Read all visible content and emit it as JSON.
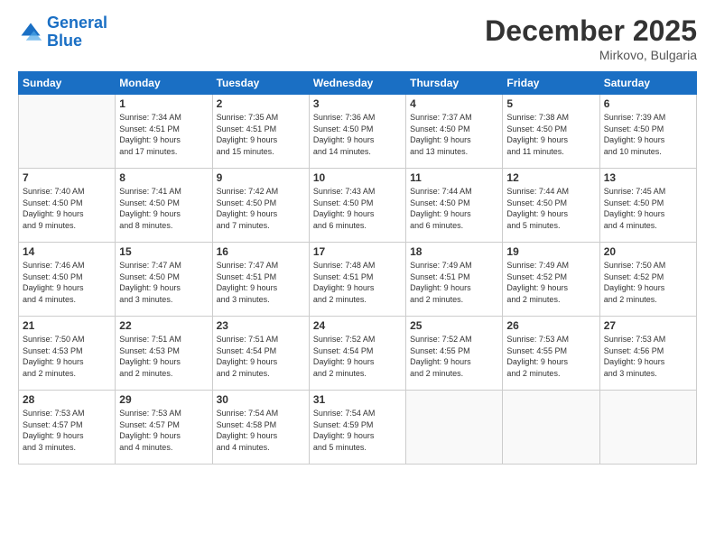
{
  "header": {
    "logo_line1": "General",
    "logo_line2": "Blue",
    "month": "December 2025",
    "location": "Mirkovo, Bulgaria"
  },
  "weekdays": [
    "Sunday",
    "Monday",
    "Tuesday",
    "Wednesday",
    "Thursday",
    "Friday",
    "Saturday"
  ],
  "weeks": [
    [
      {
        "day": "",
        "info": ""
      },
      {
        "day": "1",
        "info": "Sunrise: 7:34 AM\nSunset: 4:51 PM\nDaylight: 9 hours\nand 17 minutes."
      },
      {
        "day": "2",
        "info": "Sunrise: 7:35 AM\nSunset: 4:51 PM\nDaylight: 9 hours\nand 15 minutes."
      },
      {
        "day": "3",
        "info": "Sunrise: 7:36 AM\nSunset: 4:50 PM\nDaylight: 9 hours\nand 14 minutes."
      },
      {
        "day": "4",
        "info": "Sunrise: 7:37 AM\nSunset: 4:50 PM\nDaylight: 9 hours\nand 13 minutes."
      },
      {
        "day": "5",
        "info": "Sunrise: 7:38 AM\nSunset: 4:50 PM\nDaylight: 9 hours\nand 11 minutes."
      },
      {
        "day": "6",
        "info": "Sunrise: 7:39 AM\nSunset: 4:50 PM\nDaylight: 9 hours\nand 10 minutes."
      }
    ],
    [
      {
        "day": "7",
        "info": "Sunrise: 7:40 AM\nSunset: 4:50 PM\nDaylight: 9 hours\nand 9 minutes."
      },
      {
        "day": "8",
        "info": "Sunrise: 7:41 AM\nSunset: 4:50 PM\nDaylight: 9 hours\nand 8 minutes."
      },
      {
        "day": "9",
        "info": "Sunrise: 7:42 AM\nSunset: 4:50 PM\nDaylight: 9 hours\nand 7 minutes."
      },
      {
        "day": "10",
        "info": "Sunrise: 7:43 AM\nSunset: 4:50 PM\nDaylight: 9 hours\nand 6 minutes."
      },
      {
        "day": "11",
        "info": "Sunrise: 7:44 AM\nSunset: 4:50 PM\nDaylight: 9 hours\nand 6 minutes."
      },
      {
        "day": "12",
        "info": "Sunrise: 7:44 AM\nSunset: 4:50 PM\nDaylight: 9 hours\nand 5 minutes."
      },
      {
        "day": "13",
        "info": "Sunrise: 7:45 AM\nSunset: 4:50 PM\nDaylight: 9 hours\nand 4 minutes."
      }
    ],
    [
      {
        "day": "14",
        "info": "Sunrise: 7:46 AM\nSunset: 4:50 PM\nDaylight: 9 hours\nand 4 minutes."
      },
      {
        "day": "15",
        "info": "Sunrise: 7:47 AM\nSunset: 4:50 PM\nDaylight: 9 hours\nand 3 minutes."
      },
      {
        "day": "16",
        "info": "Sunrise: 7:47 AM\nSunset: 4:51 PM\nDaylight: 9 hours\nand 3 minutes."
      },
      {
        "day": "17",
        "info": "Sunrise: 7:48 AM\nSunset: 4:51 PM\nDaylight: 9 hours\nand 2 minutes."
      },
      {
        "day": "18",
        "info": "Sunrise: 7:49 AM\nSunset: 4:51 PM\nDaylight: 9 hours\nand 2 minutes."
      },
      {
        "day": "19",
        "info": "Sunrise: 7:49 AM\nSunset: 4:52 PM\nDaylight: 9 hours\nand 2 minutes."
      },
      {
        "day": "20",
        "info": "Sunrise: 7:50 AM\nSunset: 4:52 PM\nDaylight: 9 hours\nand 2 minutes."
      }
    ],
    [
      {
        "day": "21",
        "info": "Sunrise: 7:50 AM\nSunset: 4:53 PM\nDaylight: 9 hours\nand 2 minutes."
      },
      {
        "day": "22",
        "info": "Sunrise: 7:51 AM\nSunset: 4:53 PM\nDaylight: 9 hours\nand 2 minutes."
      },
      {
        "day": "23",
        "info": "Sunrise: 7:51 AM\nSunset: 4:54 PM\nDaylight: 9 hours\nand 2 minutes."
      },
      {
        "day": "24",
        "info": "Sunrise: 7:52 AM\nSunset: 4:54 PM\nDaylight: 9 hours\nand 2 minutes."
      },
      {
        "day": "25",
        "info": "Sunrise: 7:52 AM\nSunset: 4:55 PM\nDaylight: 9 hours\nand 2 minutes."
      },
      {
        "day": "26",
        "info": "Sunrise: 7:53 AM\nSunset: 4:55 PM\nDaylight: 9 hours\nand 2 minutes."
      },
      {
        "day": "27",
        "info": "Sunrise: 7:53 AM\nSunset: 4:56 PM\nDaylight: 9 hours\nand 3 minutes."
      }
    ],
    [
      {
        "day": "28",
        "info": "Sunrise: 7:53 AM\nSunset: 4:57 PM\nDaylight: 9 hours\nand 3 minutes."
      },
      {
        "day": "29",
        "info": "Sunrise: 7:53 AM\nSunset: 4:57 PM\nDaylight: 9 hours\nand 4 minutes."
      },
      {
        "day": "30",
        "info": "Sunrise: 7:54 AM\nSunset: 4:58 PM\nDaylight: 9 hours\nand 4 minutes."
      },
      {
        "day": "31",
        "info": "Sunrise: 7:54 AM\nSunset: 4:59 PM\nDaylight: 9 hours\nand 5 minutes."
      },
      {
        "day": "",
        "info": ""
      },
      {
        "day": "",
        "info": ""
      },
      {
        "day": "",
        "info": ""
      }
    ]
  ]
}
